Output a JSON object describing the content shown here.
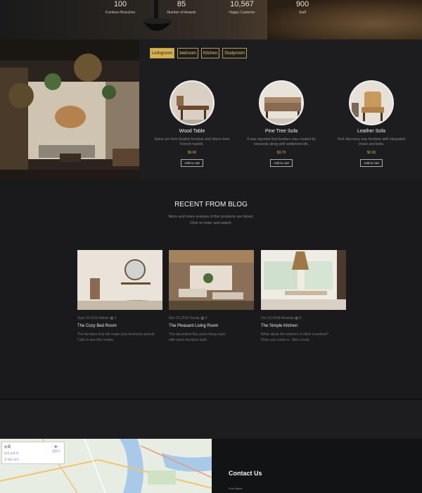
{
  "stats": [
    {
      "num": "100",
      "label": "Furniture Branches"
    },
    {
      "num": "85",
      "label": "Number of Awards"
    },
    {
      "num": "10,567",
      "label": "Happy Customer"
    },
    {
      "num": "900",
      "label": "Staff"
    }
  ],
  "tabs": [
    "Livingroom",
    "bedroom",
    "Kitchen",
    "Studyroom"
  ],
  "products": [
    {
      "name": "Wood Table",
      "desc": "Some are from English furniture and others from French marble.",
      "price": "$5.90",
      "cart": "Add to cart"
    },
    {
      "name": "Pine Tree Sofa",
      "desc": "It was reported that furniture was created by necessity along with settlement life.",
      "price": "$3.70",
      "cart": "Add to cart"
    },
    {
      "name": "Leather Sofa",
      "desc": "First discovery was furniture with integrated chairs and beds.",
      "price": "$2.90",
      "cart": "Add to cart"
    }
  ],
  "blog": {
    "title": "RECENT FROM BLOG",
    "subtitle_1": "More and more reviews of the products are listed.",
    "subtitle_2": "Click to enter and watch.",
    "posts": [
      {
        "date": "Sept 10,2018",
        "author": "Admin",
        "comments": "3",
        "title": "The Cozy Bed Room",
        "desc_1": "The furniture that will make your bedroom special.",
        "desc_2": "Click to see this review."
      },
      {
        "date": "Nov 22,2019",
        "author": "Sandy",
        "comments": "3",
        "title": "The Pleasant Living Room",
        "desc_1": "The decorated this years living room",
        "desc_2": "with warm furniture style."
      },
      {
        "date": "Oct 13,2018",
        "author": "Amanda",
        "comments": "6",
        "title": "The Simple Kitchen",
        "desc_1": "What about the interiors of other countries?",
        "desc_2": "Once you come in, Take a look."
      }
    ]
  },
  "map": {
    "line1": "뉴욕",
    "line2": "미국 뉴욕 주",
    "line3": "큰 지도 보기",
    "directions": "길찾기"
  },
  "contact": {
    "title": "Contact Us",
    "first_name_label": "First Name"
  },
  "colors": {
    "accent": "#d8b24e",
    "bg": "#1b1b1d"
  }
}
